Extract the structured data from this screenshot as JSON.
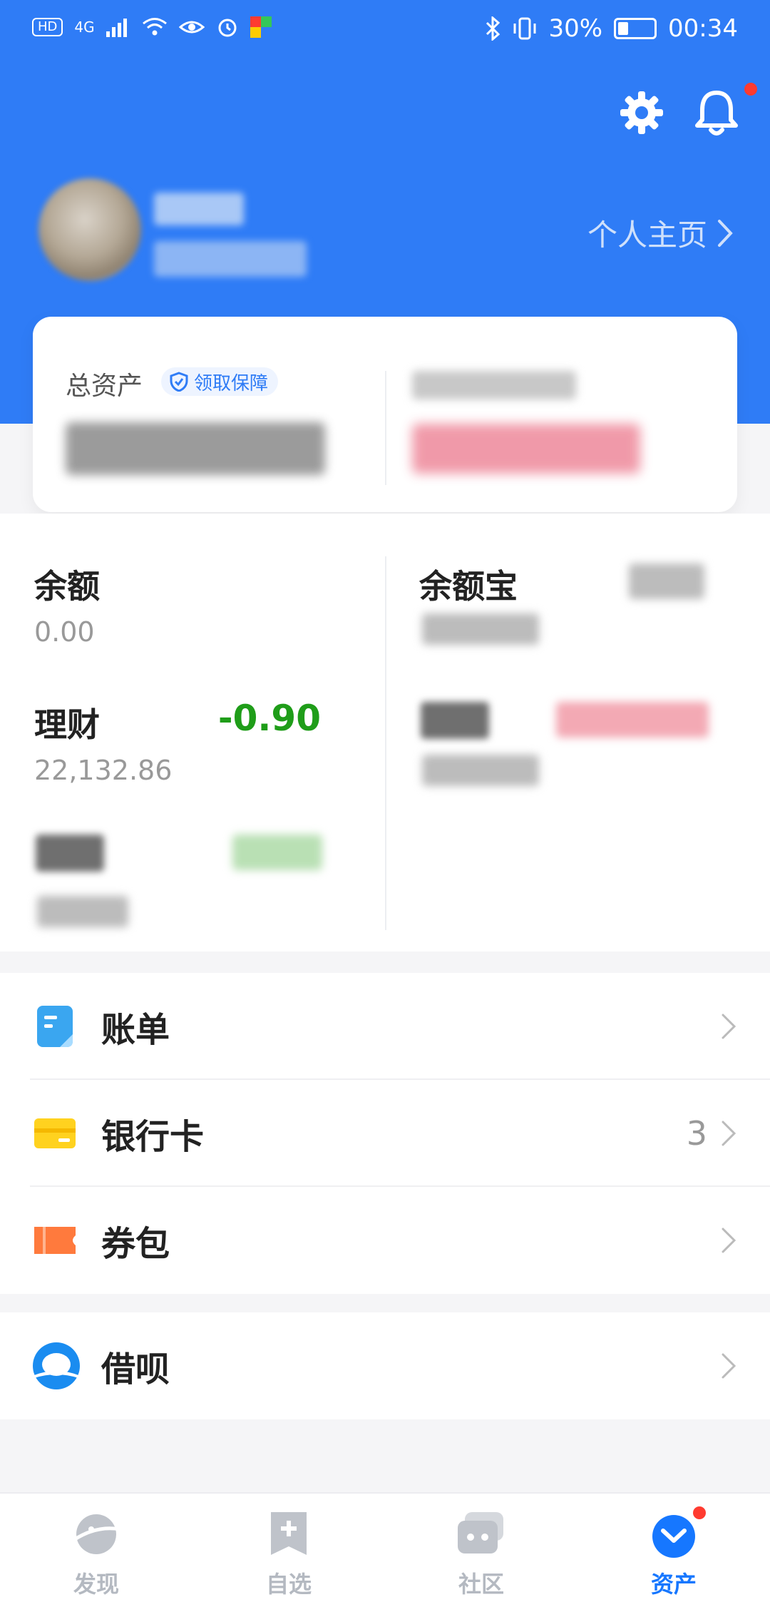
{
  "status_bar": {
    "left_badge": "HD",
    "network": "4G",
    "battery": "30%",
    "time": "00:34"
  },
  "header": {
    "profile_link": "个人主页"
  },
  "summary": {
    "total_assets_label": "总资产",
    "protection_badge": "领取保障"
  },
  "assets": {
    "balance": {
      "name": "余额",
      "value": "0.00"
    },
    "yuebao": {
      "name": "余额宝"
    },
    "wealth": {
      "name": "理财",
      "value": "22,132.86",
      "change": "-0.90"
    }
  },
  "menu": {
    "bill": "账单",
    "bank_card": "银行卡",
    "bank_card_count": "3",
    "coupon": "券包",
    "jiebei": "借呗"
  },
  "tabs": [
    {
      "label": "发现"
    },
    {
      "label": "自选"
    },
    {
      "label": "社区"
    },
    {
      "label": "资产"
    }
  ],
  "colors": {
    "header_blue": "#2f7cf6",
    "positive_green": "#1f9d19",
    "active_tab": "#1677ff",
    "badge_red": "#ff3b30"
  }
}
